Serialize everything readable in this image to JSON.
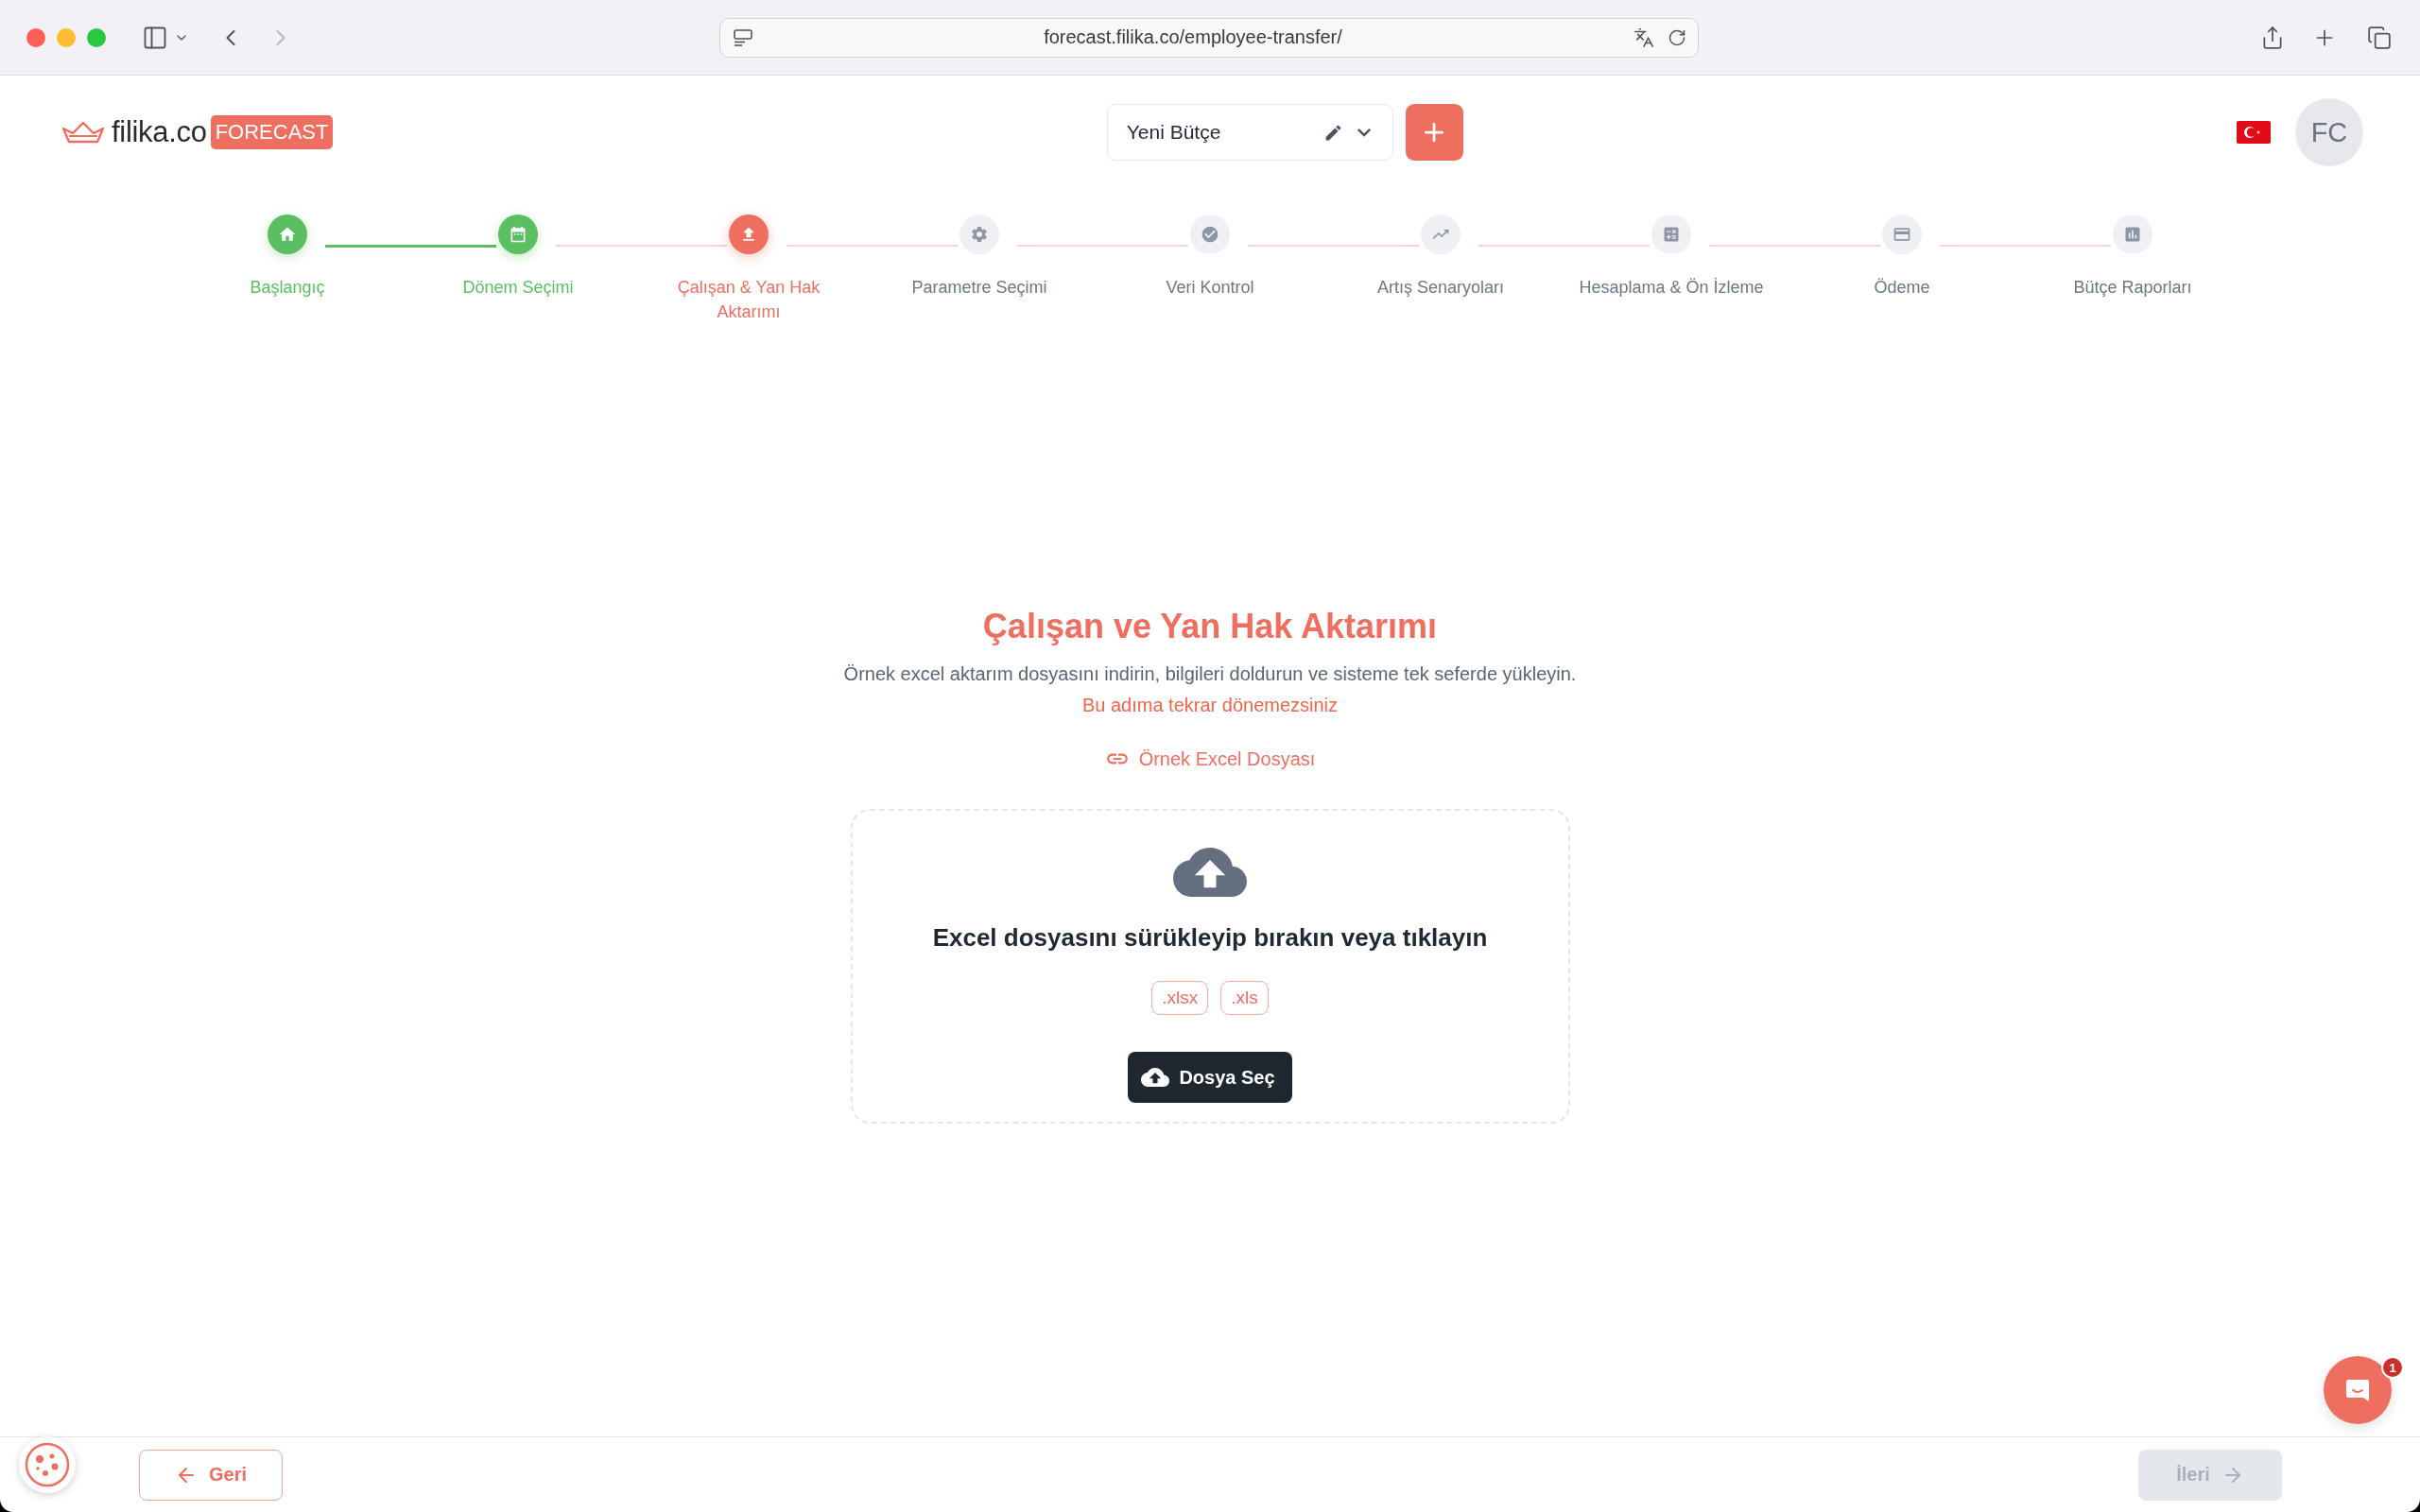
{
  "browser": {
    "url": "forecast.filika.co/employee-transfer/"
  },
  "header": {
    "logo": {
      "name": "filika.co",
      "badge": "FORECAST"
    },
    "budget_select": {
      "value": "Yeni Bütçe"
    },
    "avatar": {
      "initials": "FC"
    }
  },
  "stepper": {
    "steps": [
      {
        "label": "Başlangıç",
        "completed": true,
        "selected": false
      },
      {
        "label": "Dönem Seçimi",
        "completed": true,
        "selected": false
      },
      {
        "label": "Çalışan & Yan Hak Aktarımı",
        "completed": false,
        "selected": true
      },
      {
        "label": "Parametre Seçimi",
        "completed": false,
        "selected": false
      },
      {
        "label": "Veri Kontrol",
        "completed": false,
        "selected": false
      },
      {
        "label": "Artış Senaryoları",
        "completed": false,
        "selected": false
      },
      {
        "label": "Hesaplama & Ön İzleme",
        "completed": false,
        "selected": false
      },
      {
        "label": "Ödeme",
        "completed": false,
        "selected": false
      },
      {
        "label": "Bütçe Raporları",
        "completed": false,
        "selected": false
      }
    ]
  },
  "upload": {
    "title": "Çalışan ve Yan Hak Aktarımı",
    "description": "Örnek excel aktarım dosyasını indirin, bilgileri doldurun ve sisteme tek seferde yükleyin.",
    "warning": "Bu adıma tekrar dönemezsiniz",
    "sample_link": "Örnek Excel Dosyası",
    "dropzone": {
      "prompt": "Excel dosyasını sürükleyip bırakın veya tıklayın",
      "formats": [
        ".xlsx",
        ".xls"
      ],
      "button": "Dosya Seç"
    }
  },
  "footer": {
    "buttons": [
      {
        "kind": "back",
        "label": "Geri",
        "disabled": false
      },
      {
        "kind": "next",
        "label": "İleri",
        "disabled": true
      }
    ]
  },
  "chat": {
    "unread": "1"
  }
}
